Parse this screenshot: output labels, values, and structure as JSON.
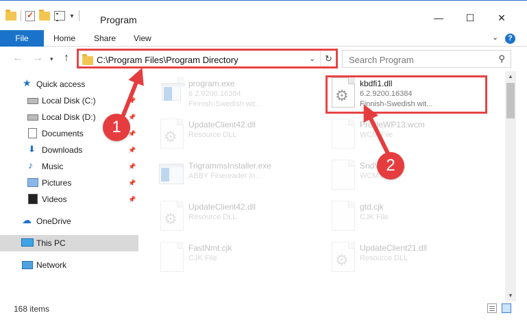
{
  "window": {
    "title": "Program",
    "minimize": "—",
    "maximize": "☐",
    "close": "✕"
  },
  "ribbon": {
    "tabs": [
      "File",
      "Home",
      "Share",
      "View"
    ],
    "help": "?"
  },
  "address": {
    "path": "C:\\Program Files\\Program Directory",
    "search_placeholder": "Search Program"
  },
  "sidebar": {
    "items": [
      {
        "label": "Quick access",
        "icon": "star-icon"
      },
      {
        "label": "Local Disk (C:)",
        "icon": "drive-icon",
        "pinned": true
      },
      {
        "label": "Local Disk (D:)",
        "icon": "drive-icon",
        "pinned": true
      },
      {
        "label": "Documents",
        "icon": "documents-icon",
        "pinned": true
      },
      {
        "label": "Downloads",
        "icon": "downloads-icon",
        "pinned": true
      },
      {
        "label": "Music",
        "icon": "music-icon",
        "pinned": true
      },
      {
        "label": "Pictures",
        "icon": "pictures-icon",
        "pinned": true
      },
      {
        "label": "Videos",
        "icon": "videos-icon",
        "pinned": true
      },
      {
        "label": "OneDrive",
        "icon": "onedrive-icon"
      },
      {
        "label": "This PC",
        "icon": "this-pc-icon",
        "selected": true
      },
      {
        "label": "Network",
        "icon": "network-icon"
      }
    ]
  },
  "files": [
    {
      "name": "program.exe",
      "type": "6.2.9200.16384",
      "sub": "Finnish-Swedish wit...",
      "icon": "exe-icon"
    },
    {
      "name": "kbdfi1.dll",
      "type": "6.2.9200.16384",
      "sub": "Finnish-Swedish wit...",
      "icon": "dll-icon",
      "highlighted": true
    },
    {
      "name": "UpdateClient42.dll",
      "type": "Resource DLL",
      "icon": "dll-icon"
    },
    {
      "name": "ProfileWP13.wcm",
      "type": "WCM File",
      "icon": "file-icon"
    },
    {
      "name": "TrigrammsInstaller.exe",
      "type": "ABBY Finereader In...",
      "icon": "exe-icon"
    },
    {
      "name": "SndVol.wcm",
      "type": "WCM File",
      "icon": "file-icon"
    },
    {
      "name": "UpdateClient42.dll",
      "type": "Resource DLL",
      "icon": "dll-icon"
    },
    {
      "name": "gtd.cjk",
      "type": "CJK File",
      "icon": "file-icon"
    },
    {
      "name": "FastNmt.cjk",
      "type": "CJK File",
      "icon": "file-icon"
    },
    {
      "name": "UpdateClient21.dll",
      "type": "Resource DLL",
      "icon": "dll-icon"
    }
  ],
  "status": {
    "item_count": "168 items"
  },
  "annotations": {
    "step1": "1",
    "step2": "2",
    "color": "#e53d3f"
  }
}
